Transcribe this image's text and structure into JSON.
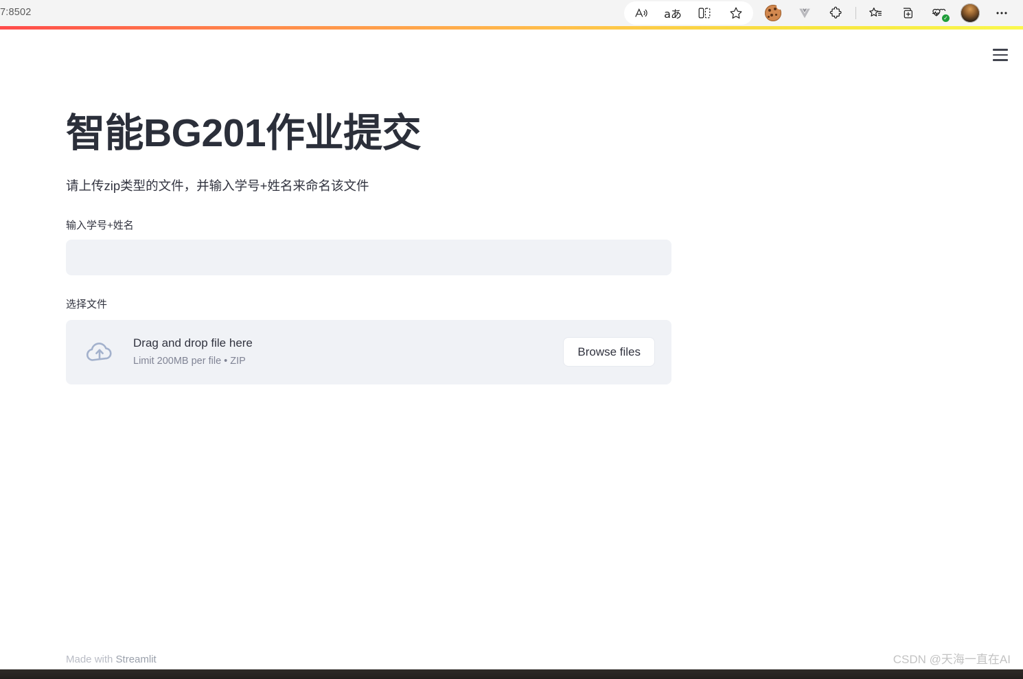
{
  "browser": {
    "url_text": "7:8502",
    "toolbar_icons": [
      {
        "name": "read-aloud-icon",
        "glyph": "A"
      },
      {
        "name": "translate-icon",
        "glyph": "aあ"
      },
      {
        "name": "split-screen-icon",
        "glyph": "split"
      },
      {
        "name": "favorite-star-icon",
        "glyph": "★"
      },
      {
        "name": "cookie-extension-icon",
        "glyph": "cookie"
      },
      {
        "name": "vue-devtools-extension-icon",
        "glyph": "V"
      },
      {
        "name": "extensions-puzzle-icon",
        "glyph": "puzzle"
      },
      {
        "name": "collections-icon",
        "glyph": "collections"
      },
      {
        "name": "add-tab-icon",
        "glyph": "tab-plus"
      },
      {
        "name": "browser-essentials-icon",
        "glyph": "heartbeat"
      },
      {
        "name": "profile-avatar",
        "glyph": "avatar"
      },
      {
        "name": "settings-more-icon",
        "glyph": "…"
      }
    ]
  },
  "app": {
    "menu_label": "menu",
    "title": "智能BG201作业提交",
    "subtitle": "请上传zip类型的文件，并输入学号+姓名来命名该文件",
    "name_field": {
      "label": "输入学号+姓名",
      "value": "",
      "placeholder": ""
    },
    "file_field": {
      "label": "选择文件",
      "dropzone_title": "Drag and drop file here",
      "dropzone_limit": "Limit 200MB per file • ZIP",
      "browse_label": "Browse files",
      "upload_icon": "cloud-upload-icon"
    },
    "footer": {
      "made_with": "Made with ",
      "brand": "Streamlit"
    }
  },
  "watermark": "CSDN @天海一直在AI",
  "colors": {
    "accent_gradient_start": "#ff4b4b",
    "accent_gradient_end": "#faf84e",
    "widget_bg": "#f0f2f6",
    "text_primary": "#31333f",
    "text_muted": "#808495"
  }
}
